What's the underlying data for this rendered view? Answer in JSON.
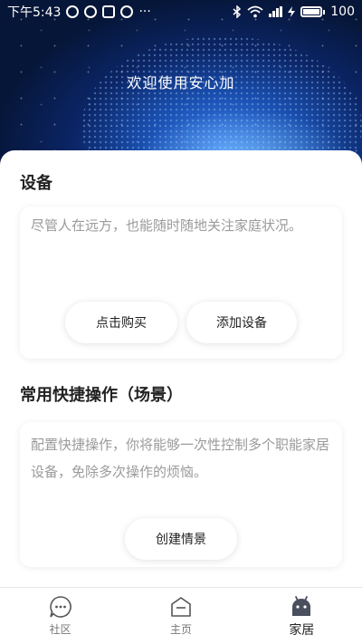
{
  "status_bar": {
    "time": "下午5:43",
    "more": "···",
    "signal": "4G",
    "battery": "100"
  },
  "hero": {
    "title": "欢迎使用安心加"
  },
  "devices": {
    "title": "设备",
    "description": "尽管人在远方，也能随时随地关注家庭状况。",
    "buy_button": "点击购买",
    "add_button": "添加设备"
  },
  "scenes": {
    "title": "常用快捷操作（场景）",
    "description": "配置快捷操作，你将能够一次性控制多个职能家居设备，免除多次操作的烦恼。",
    "create_button": "创建情景"
  },
  "bottom_nav": {
    "items": [
      {
        "label": "社区",
        "icon": "chat-icon",
        "active": false
      },
      {
        "label": "主页",
        "icon": "home-icon",
        "active": false
      },
      {
        "label": "家居",
        "icon": "android-icon",
        "active": true
      }
    ]
  },
  "colors": {
    "accent": "#3b7ff0",
    "icon_dark": "#4a4f5e"
  }
}
